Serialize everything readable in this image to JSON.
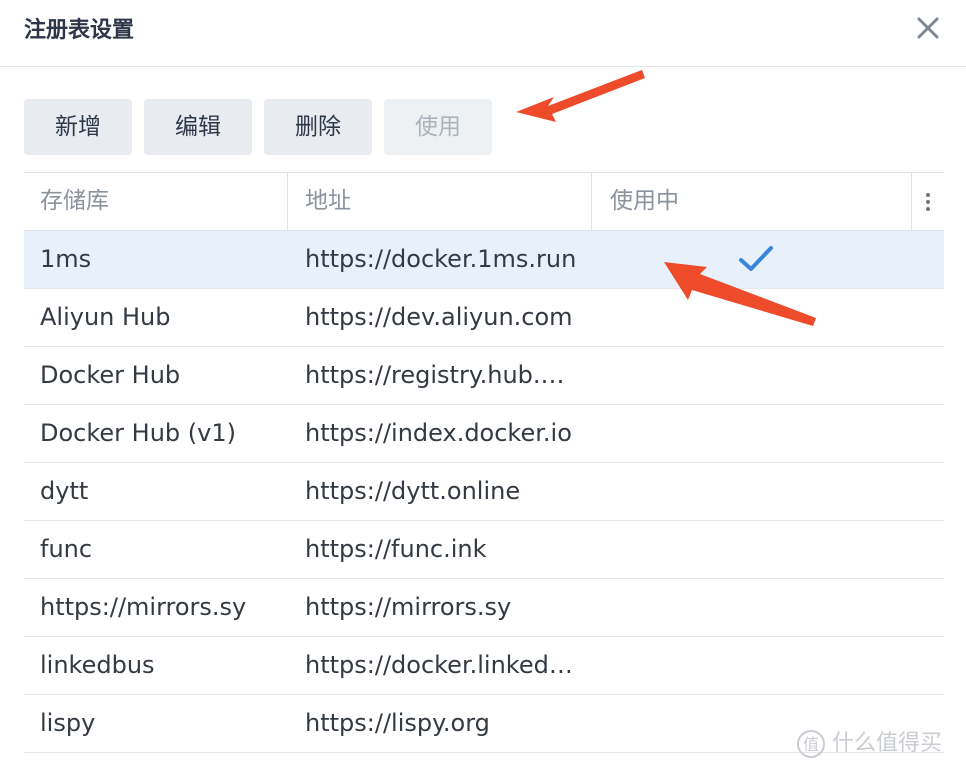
{
  "dialog": {
    "title": "注册表设置",
    "close_icon": "close-icon"
  },
  "toolbar": {
    "add_label": "新增",
    "edit_label": "编辑",
    "delete_label": "删除",
    "use_label": "使用"
  },
  "table": {
    "columns": [
      "存储库",
      "地址",
      "使用中"
    ],
    "menu_icon": "vertical-dots-icon",
    "rows": [
      {
        "name": "1ms",
        "url": "https://docker.1ms.run",
        "in_use": true,
        "selected": true
      },
      {
        "name": "Aliyun Hub",
        "url": "https://dev.aliyun.com",
        "in_use": false,
        "selected": false
      },
      {
        "name": "Docker Hub",
        "url": "https://registry.hub.docker.com",
        "in_use": false,
        "selected": false
      },
      {
        "name": "Docker Hub (v1)",
        "url": "https://index.docker.io",
        "in_use": false,
        "selected": false
      },
      {
        "name": "dytt",
        "url": "https://dytt.online",
        "in_use": false,
        "selected": false
      },
      {
        "name": "func",
        "url": "https://func.ink",
        "in_use": false,
        "selected": false
      },
      {
        "name": "https://mirrors.sy",
        "url": "https://mirrors.sy",
        "in_use": false,
        "selected": false
      },
      {
        "name": "linkedbus",
        "url": "https://docker.linkedbus.com",
        "in_use": false,
        "selected": false
      },
      {
        "name": "lispy",
        "url": "https://lispy.org",
        "in_use": false,
        "selected": false
      }
    ]
  },
  "watermark": {
    "text": "什么值得买",
    "icon": "smzdm-logo-icon"
  },
  "colors": {
    "accent": "#3a86d8",
    "annotation_arrow": "#ee4b2b",
    "selected_row": "#e8f1fb"
  }
}
